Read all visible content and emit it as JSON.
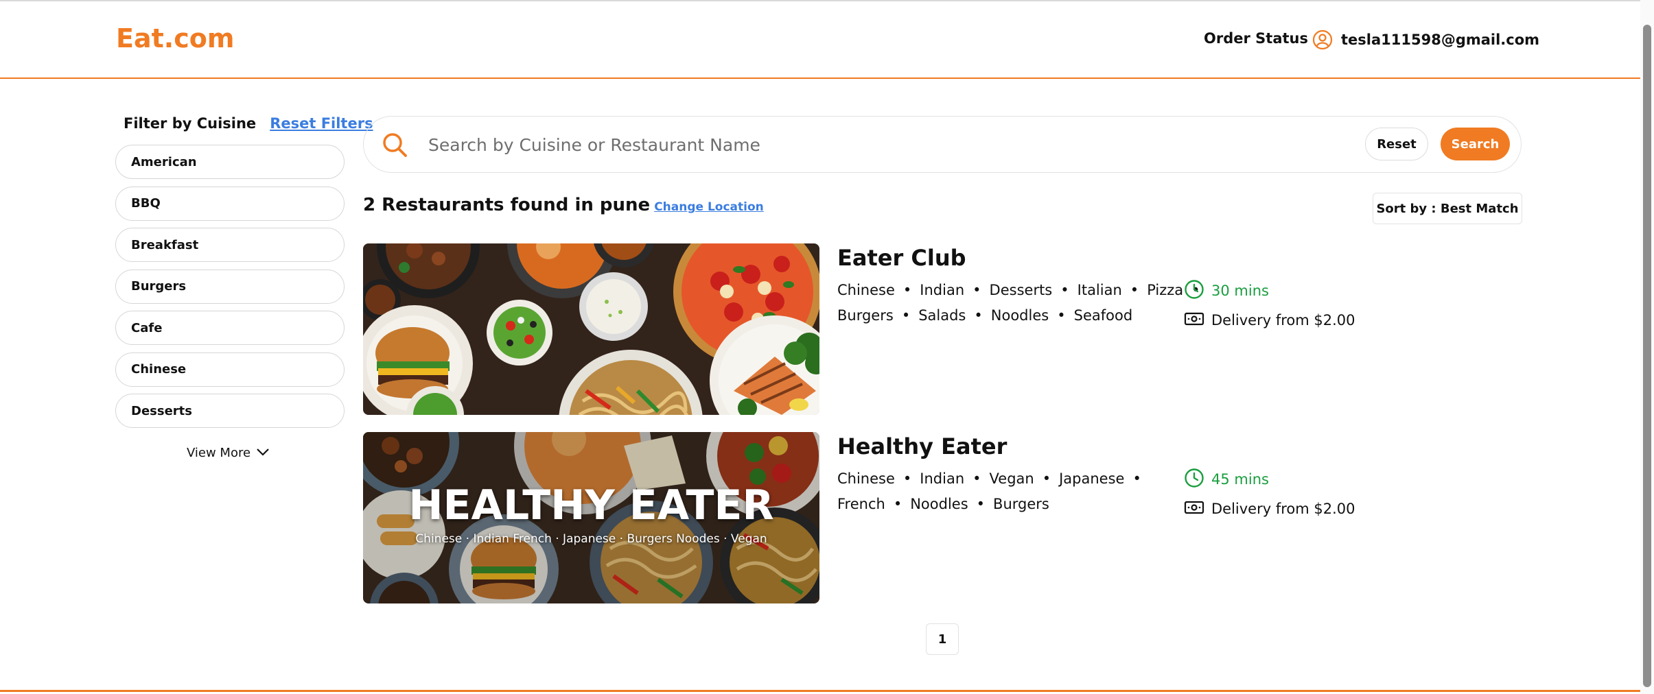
{
  "header": {
    "logo": "Eat.com",
    "order_status": "Order Status",
    "user_email": "tesla111598@gmail.com"
  },
  "colors": {
    "brand": "#f07b22",
    "link": "#3b7de0",
    "time_green": "#1a9e3f"
  },
  "sidebar": {
    "title": "Filter by Cuisine",
    "reset_label": "Reset Filters",
    "items": [
      {
        "label": "American"
      },
      {
        "label": "BBQ"
      },
      {
        "label": "Breakfast"
      },
      {
        "label": "Burgers"
      },
      {
        "label": "Cafe"
      },
      {
        "label": "Chinese"
      },
      {
        "label": "Desserts"
      }
    ],
    "view_more": "View More"
  },
  "search": {
    "placeholder": "Search by Cuisine or Restaurant Name",
    "value": "",
    "reset_label": "Reset",
    "search_label": "Search"
  },
  "results": {
    "title": "2 Restaurants found in pune",
    "change_location": "Change Location",
    "sort_label": "Sort by : Best Match"
  },
  "restaurants": [
    {
      "name": "Eater Club",
      "cuisines_line1": [
        "Chinese",
        "Indian",
        "Desserts",
        "Italian",
        "Pizza"
      ],
      "cuisines_line2": [
        "Burgers",
        "Salads",
        "Noodles",
        "Seafood"
      ],
      "time": "30 mins",
      "delivery": "Delivery from $2.00"
    },
    {
      "name": "Healthy Eater",
      "cuisines_line1": [
        "Chinese",
        "Indian",
        "Vegan",
        "Japanese"
      ],
      "cuisines_line2": [
        "French",
        "Noodles",
        "Burgers"
      ],
      "time": "45 mins",
      "delivery": "Delivery from $2.00",
      "image_title": "HEALTHY EATER",
      "image_subtitle": "Chinese · Indian   French · Japanese · Burgers  Noodes · Vegan"
    }
  ],
  "pagination": {
    "current": "1"
  },
  "icons": {
    "user": "user-circle-icon",
    "search": "search-icon",
    "chevron": "chevron-down-icon",
    "clock": "clock-icon",
    "delivery": "cash-icon"
  }
}
